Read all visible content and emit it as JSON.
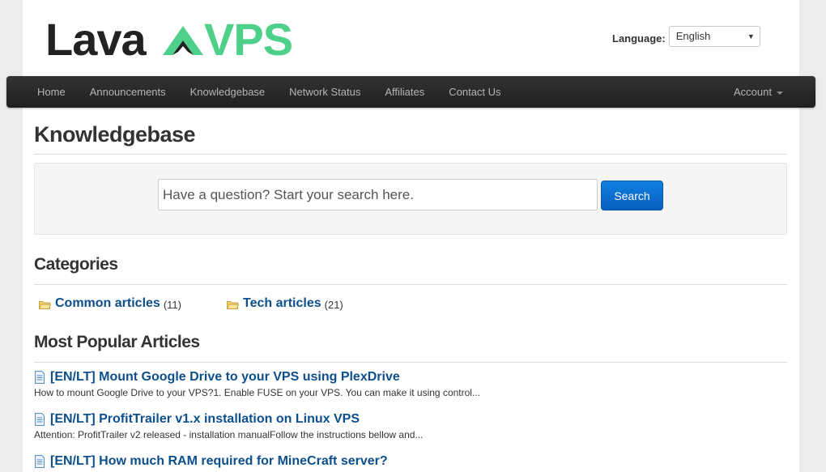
{
  "header": {
    "logo_text_left": "Lava",
    "logo_text_right": "VPS",
    "language_label": "Language:",
    "language_selected": "English"
  },
  "nav": {
    "items": [
      {
        "label": "Home"
      },
      {
        "label": "Announcements"
      },
      {
        "label": "Knowledgebase"
      },
      {
        "label": "Network Status"
      },
      {
        "label": "Affiliates"
      },
      {
        "label": "Contact Us"
      }
    ],
    "account_label": "Account"
  },
  "main": {
    "page_title": "Knowledgebase",
    "search": {
      "placeholder": "Have a question? Start your search here.",
      "button_label": "Search"
    },
    "categories_heading": "Categories",
    "categories": [
      {
        "label": "Common articles",
        "count": "(11)"
      },
      {
        "label": "Tech articles",
        "count": "(21)"
      }
    ],
    "popular_heading": "Most Popular Articles",
    "articles": [
      {
        "title": "[EN/LT] Mount Google Drive to your VPS using PlexDrive",
        "desc": "How to mount Google Drive to your VPS?1. Enable FUSE on your VPS. You can make it using control..."
      },
      {
        "title": "[EN/LT] ProfitTrailer v1.x installation on Linux VPS",
        "desc": "Attention: ProfitTrailer v2 released - installation manualFollow the instructions bellow and..."
      },
      {
        "title": "[EN/LT] How much RAM required for MineCraft server?",
        "desc": ""
      }
    ]
  },
  "colors": {
    "brand_dark": "#222222",
    "brand_green": "#4fd08a",
    "link": "#0c4f8c",
    "navbar": "#262626",
    "button_blue": "#0a6ed1"
  }
}
